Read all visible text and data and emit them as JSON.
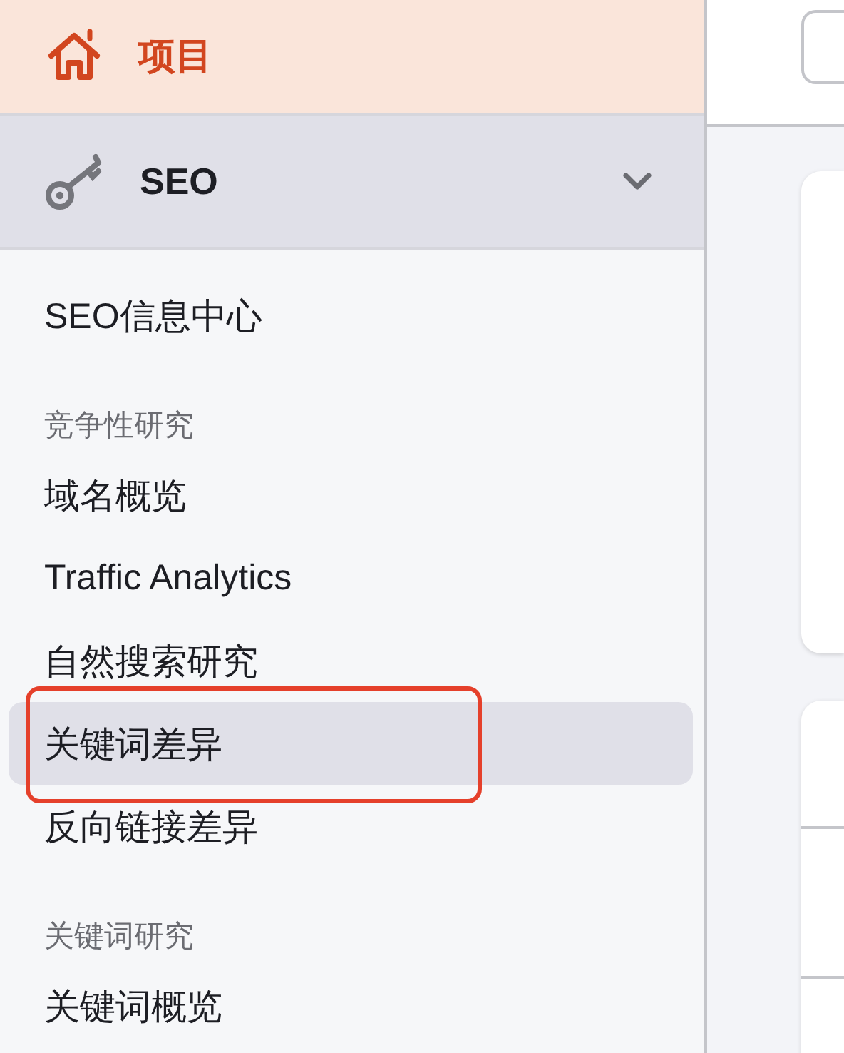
{
  "sidebar": {
    "home": {
      "label": "项目"
    },
    "section": {
      "label": "SEO",
      "expanded": true
    },
    "groups": [
      {
        "items": [
          {
            "label": "SEO信息中心",
            "selected": false
          }
        ]
      },
      {
        "heading": "竞争性研究",
        "items": [
          {
            "label": "域名概览",
            "selected": false
          },
          {
            "label": "Traffic Analytics",
            "selected": false
          },
          {
            "label": "自然搜索研究",
            "selected": false
          },
          {
            "label": "关键词差异",
            "selected": true
          },
          {
            "label": "反向链接差异",
            "selected": false
          }
        ]
      },
      {
        "heading": "关键词研究",
        "items": [
          {
            "label": "关键词概览",
            "selected": false
          }
        ]
      }
    ]
  },
  "annotation": {
    "kind": "frame",
    "color": "#e5402b"
  }
}
